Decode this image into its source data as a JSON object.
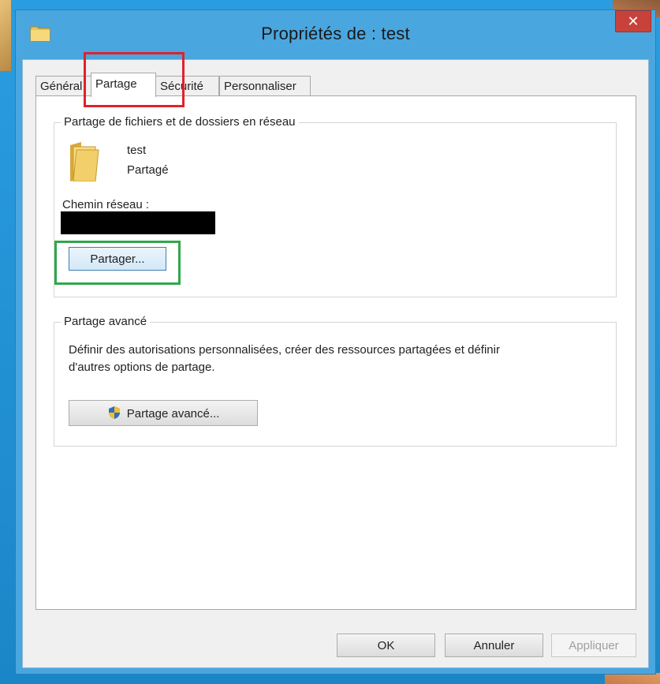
{
  "window": {
    "title": "Propriétés de : test",
    "close_glyph": "✕"
  },
  "tabs": [
    {
      "label": "Général"
    },
    {
      "label": "Partage"
    },
    {
      "label": "Sécurité"
    },
    {
      "label": "Personnaliser"
    }
  ],
  "active_tab": "Partage",
  "network_sharing": {
    "group_title": "Partage de fichiers et de dossiers en réseau",
    "folder_name": "test",
    "share_status": "Partagé",
    "network_path_label": "Chemin réseau :",
    "share_button": "Partager..."
  },
  "advanced_sharing": {
    "group_title": "Partage avancé",
    "description_line1": "Définir des autorisations personnalisées, créer des ressources partagées et définir",
    "description_line2": "d'autres options de partage.",
    "button": "Partage avancé..."
  },
  "footer": {
    "ok": "OK",
    "cancel": "Annuler",
    "apply": "Appliquer"
  },
  "icons": {
    "title": "folder-icon",
    "close": "close-icon",
    "folder": "folder-icon",
    "shield": "uac-shield-icon"
  },
  "colors": {
    "titlebar": "#4aa6de",
    "close": "#c7423a",
    "annotation_red": "#e0222c",
    "annotation_green": "#2fa84a"
  }
}
